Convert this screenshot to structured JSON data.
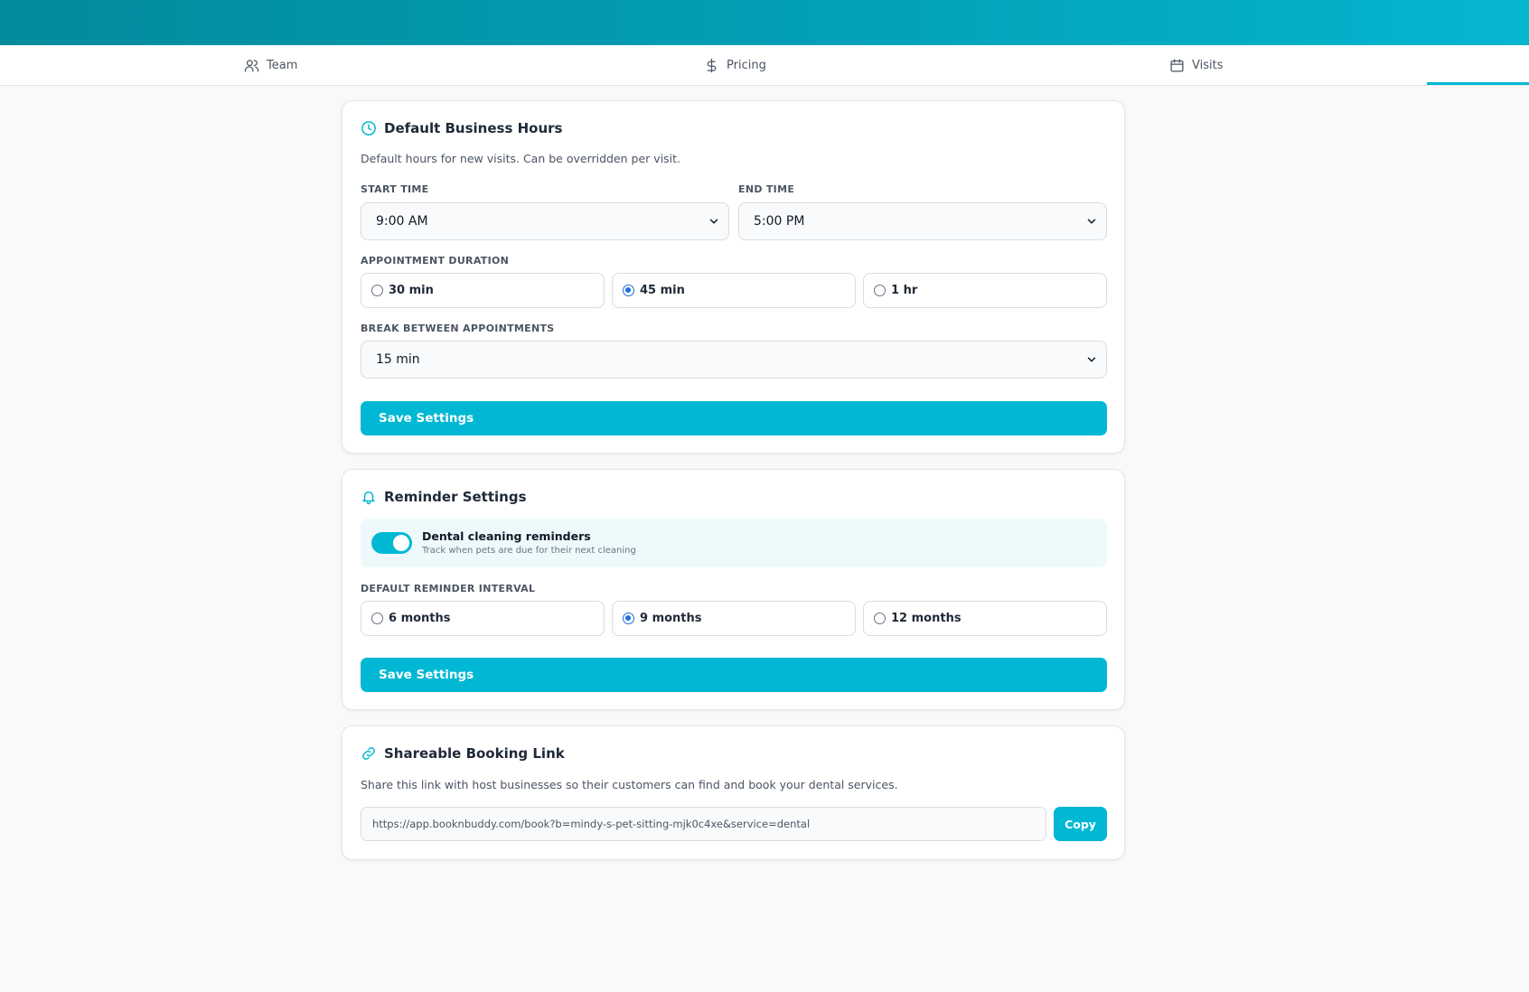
{
  "tabs": [
    {
      "label": "Team",
      "icon": "users-icon"
    },
    {
      "label": "Pricing",
      "icon": "dollar-icon"
    },
    {
      "label": "Visits",
      "icon": "calendar-icon"
    }
  ],
  "colors": {
    "accent": "#00b8d4",
    "header_start": "#028b9b",
    "header_end": "#05b6cf",
    "radio_selected": "#1d6fe0"
  },
  "business_hours": {
    "title": "Default Business Hours",
    "icon": "clock-icon",
    "description": "Default hours for new visits. Can be overridden per visit.",
    "start_label": "START TIME",
    "start_value": "9:00 AM",
    "end_label": "END TIME",
    "end_value": "5:00 PM",
    "duration_label": "APPOINTMENT DURATION",
    "duration_options": [
      "30 min",
      "45 min",
      "1 hr"
    ],
    "duration_selected": "45 min",
    "break_label": "BREAK BETWEEN APPOINTMENTS",
    "break_value": "15 min",
    "save_label": "Save Settings"
  },
  "reminders": {
    "title": "Reminder Settings",
    "icon": "bell-icon",
    "toggle_title": "Dental cleaning reminders",
    "toggle_sub": "Track when pets are due for their next cleaning",
    "toggle_on": true,
    "interval_label": "DEFAULT REMINDER INTERVAL",
    "interval_options": [
      "6 months",
      "9 months",
      "12 months"
    ],
    "interval_selected": "9 months",
    "save_label": "Save Settings"
  },
  "booking_link": {
    "title": "Shareable Booking Link",
    "icon": "link-icon",
    "description": "Share this link with host businesses so their customers can find and book your dental services.",
    "url": "https://app.booknbuddy.com/book?b=mindy-s-pet-sitting-mjk0c4xe&service=dental",
    "copy_label": "Copy"
  }
}
